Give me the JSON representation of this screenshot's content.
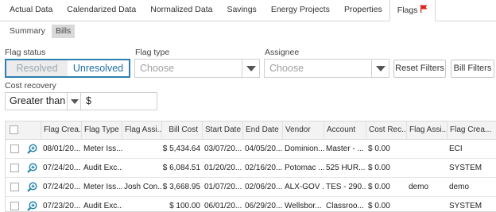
{
  "tabs": [
    {
      "label": "Actual Data"
    },
    {
      "label": "Calendarized Data"
    },
    {
      "label": "Normalized Data"
    },
    {
      "label": "Savings"
    },
    {
      "label": "Energy Projects"
    },
    {
      "label": "Properties"
    },
    {
      "label": "Flags",
      "active": true,
      "icon": "red-flag-icon"
    }
  ],
  "subtabs": [
    {
      "label": "Summary"
    },
    {
      "label": "Bills",
      "active": true
    }
  ],
  "filters": {
    "flag_status": {
      "label": "Flag status",
      "options": [
        "Resolved",
        "Unresolved"
      ],
      "selected": "Unresolved"
    },
    "flag_type": {
      "label": "Flag type",
      "placeholder": "Choose"
    },
    "assignee": {
      "label": "Assignee",
      "placeholder": "Choose"
    },
    "reset_label": "Reset Filters",
    "bill_filters_label": "Bill Filters",
    "cost_recovery": {
      "label": "Cost recovery",
      "operator": "Greater than",
      "currency": "$"
    }
  },
  "grid": {
    "columns": [
      "Flag Crea...",
      "Flag Type",
      "Flag Assi...",
      "Bill Cost",
      "Start Date",
      "End Date",
      "Vendor",
      "Account",
      "Cost Rec...",
      "Flag Assi...",
      "Flag Crea..."
    ],
    "rows": [
      [
        "08/01/20...",
        "Meter Iss...",
        "",
        "$ 5,434.64",
        "03/07/20...",
        "04/05/20...",
        "Dominion...",
        "Master - ...",
        "$ 0.00",
        "",
        "ECI"
      ],
      [
        "07/24/20...",
        "Audit Exc...",
        "",
        "$ 6,084.51",
        "01/20/20...",
        "02/16/20...",
        "Potomac ...",
        "525 HUR...",
        "$ 0.00",
        "",
        "SYSTEM"
      ],
      [
        "07/24/20...",
        "Meter Iss...",
        "Josh Con...",
        "$ 3,668.95",
        "01/07/20...",
        "02/06/20...",
        "ALX-GOV ...",
        "TES - 290...",
        "$ 0.00",
        "demo",
        "demo"
      ],
      [
        "07/23/20...",
        "Audit Exc...",
        "",
        "$ 100.00",
        "06/01/20...",
        "06/29/20...",
        "Wellsbor...",
        "Classroo...",
        "$ 0.00",
        "",
        "SYSTEM"
      ]
    ]
  },
  "colors": {
    "accent": "#2d7fb0",
    "flag": "#d9251c"
  }
}
